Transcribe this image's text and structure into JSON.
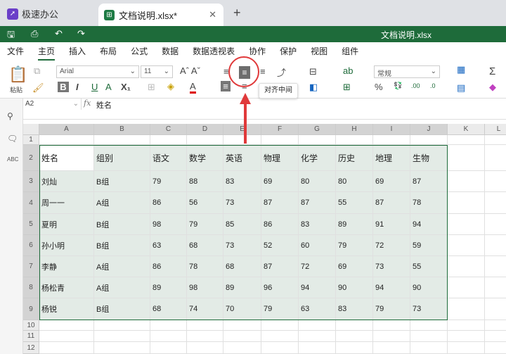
{
  "tabs": {
    "app": "极速办公",
    "doc": "文档说明.xlsx*"
  },
  "titlebar": {
    "title": "文档说明.xlsx"
  },
  "menu": [
    "文件",
    "主页",
    "插入",
    "布局",
    "公式",
    "数据",
    "数据透视表",
    "协作",
    "保护",
    "视图",
    "组件"
  ],
  "toolbar": {
    "paste": "粘贴",
    "font": "Arial",
    "size": "11",
    "number_format": "常规",
    "tooltip": "对齐中间"
  },
  "formula_bar": {
    "cell": "A2",
    "fx": "fx",
    "value": "姓名"
  },
  "sheet": {
    "columns": [
      "A",
      "B",
      "C",
      "D",
      "E",
      "F",
      "G",
      "H",
      "I",
      "J",
      "K",
      "L"
    ],
    "rows": [
      "1",
      "2",
      "3",
      "4",
      "5",
      "6",
      "7",
      "8",
      "9",
      "10",
      "11",
      "12"
    ],
    "header": [
      "姓名",
      "组别",
      "语文",
      "数学",
      "英语",
      "物理",
      "化学",
      "历史",
      "地理",
      "生物"
    ],
    "data": [
      [
        "刘灿",
        "B组",
        "79",
        "88",
        "83",
        "69",
        "80",
        "80",
        "69",
        "87"
      ],
      [
        "周一一",
        "A组",
        "86",
        "56",
        "73",
        "87",
        "87",
        "55",
        "87",
        "78"
      ],
      [
        "夏明",
        "B组",
        "98",
        "79",
        "85",
        "86",
        "83",
        "89",
        "91",
        "94"
      ],
      [
        "孙小明",
        "B组",
        "63",
        "68",
        "73",
        "52",
        "60",
        "79",
        "72",
        "59"
      ],
      [
        "李静",
        "A组",
        "86",
        "78",
        "68",
        "87",
        "72",
        "69",
        "73",
        "55"
      ],
      [
        "杨松青",
        "A组",
        "89",
        "98",
        "89",
        "96",
        "94",
        "90",
        "94",
        "90"
      ],
      [
        "杨锐",
        "B组",
        "68",
        "74",
        "70",
        "79",
        "63",
        "83",
        "79",
        "73"
      ]
    ]
  }
}
